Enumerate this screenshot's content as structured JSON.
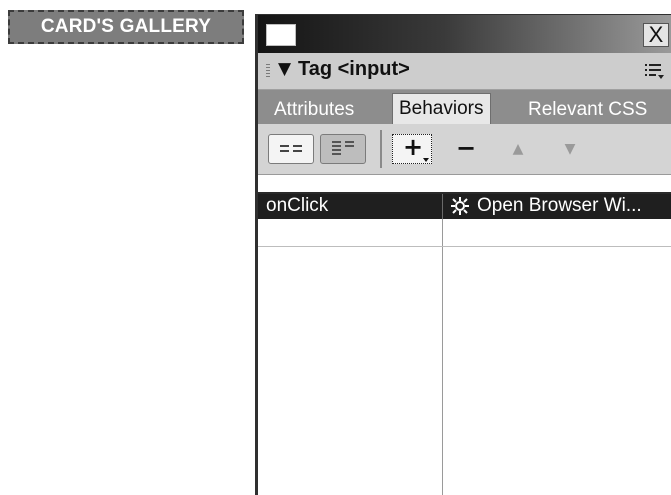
{
  "gallery_button": {
    "label": "CARD'S GALLERY"
  },
  "window": {
    "close_label": "X"
  },
  "panel": {
    "collapse_arrow": "▼",
    "title": "Tag <input>"
  },
  "tabs": [
    {
      "label": "Attributes",
      "active": false
    },
    {
      "label": "Behaviors",
      "active": true
    },
    {
      "label": "Relevant CSS",
      "active": false
    }
  ],
  "toolbar": {
    "add_label": "+",
    "remove_label": "−",
    "move_up_label": "▲",
    "move_down_label": "▼"
  },
  "behaviors": {
    "rows": [
      {
        "event": "onClick",
        "action": "Open Browser Wi..."
      },
      {
        "event": "",
        "action": ""
      }
    ]
  },
  "colors": {
    "selection": "#1f1f1f",
    "tab_strip": "#8d8d8d",
    "header": "#cdcdcd"
  }
}
